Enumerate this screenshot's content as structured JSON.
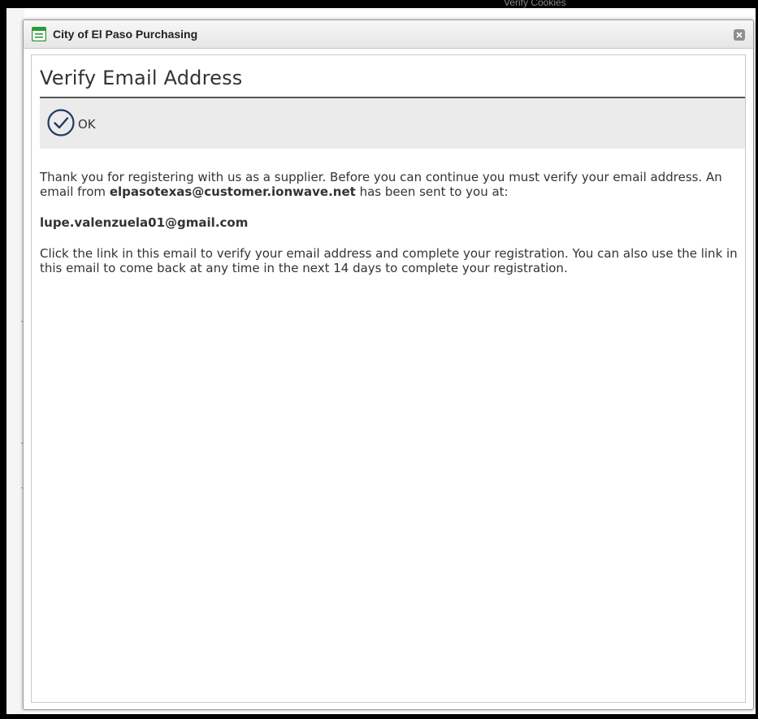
{
  "background": {
    "partial_text": "Verify Cookies"
  },
  "window": {
    "title": "City of El Paso Purchasing",
    "close_icon": "close-icon"
  },
  "page": {
    "title": "Verify Email Address",
    "ok_label": "OK",
    "ok_icon": "check-circle-icon"
  },
  "message": {
    "p1_part1": "Thank you for registering with us as a supplier. Before you can continue you must verify your email address. An email from ",
    "sender_email": "elpasotexas@customer.ionwave.net",
    "p1_part2": " has been sent to you at:",
    "recipient_email": "lupe.valenzuela01@gmail.com",
    "p2": "Click the link in this email to verify your email address and complete your registration. You can also use the link in this email to come back at any time in the next 14 days to complete your registration."
  },
  "colors": {
    "accent_icon_green": "#2e9b3a",
    "ok_icon_navy": "#1f3a64",
    "toolbar_bg": "#ebebeb"
  }
}
